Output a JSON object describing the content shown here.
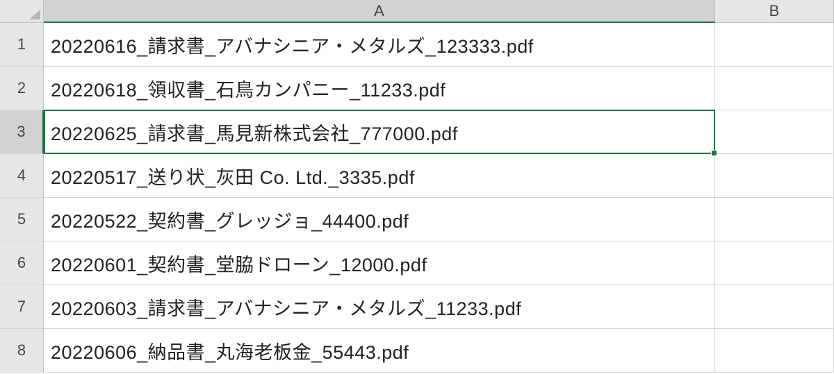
{
  "columns": [
    "A",
    "B"
  ],
  "selectedColumnIndex": 0,
  "selectedRowIndex": 2,
  "rows": [
    {
      "num": "1",
      "A": "20220616_請求書_アバナシニア・メタルズ_123333.pdf",
      "B": ""
    },
    {
      "num": "2",
      "A": "20220618_領収書_石鳥カンパニー_11233.pdf",
      "B": ""
    },
    {
      "num": "3",
      "A": "20220625_請求書_馬見新株式会社_777000.pdf",
      "B": ""
    },
    {
      "num": "4",
      "A": "20220517_送り状_灰田 Co. Ltd._3335.pdf",
      "B": ""
    },
    {
      "num": "5",
      "A": "20220522_契約書_グレッジョ_44400.pdf",
      "B": ""
    },
    {
      "num": "6",
      "A": "20220601_契約書_堂脇ドローン_12000.pdf",
      "B": ""
    },
    {
      "num": "7",
      "A": "20220603_請求書_アバナシニア・メタルズ_11233.pdf",
      "B": ""
    },
    {
      "num": "8",
      "A": "20220606_納品書_丸海老板金_55443.pdf",
      "B": ""
    }
  ],
  "chart_data": {
    "type": "table",
    "columns": [
      "A",
      "B"
    ],
    "rows": [
      [
        "20220616_請求書_アバナシニア・メタルズ_123333.pdf",
        ""
      ],
      [
        "20220618_領収書_石鳥カンパニー_11233.pdf",
        ""
      ],
      [
        "20220625_請求書_馬見新株式会社_777000.pdf",
        ""
      ],
      [
        "20220517_送り状_灰田 Co. Ltd._3335.pdf",
        ""
      ],
      [
        "20220522_契約書_グレッジョ_44400.pdf",
        ""
      ],
      [
        "20220601_契約書_堂脇ドローン_12000.pdf",
        ""
      ],
      [
        "20220603_請求書_アバナシニア・メタルズ_11233.pdf",
        ""
      ],
      [
        "20220606_納品書_丸海老板金_55443.pdf",
        ""
      ]
    ]
  }
}
